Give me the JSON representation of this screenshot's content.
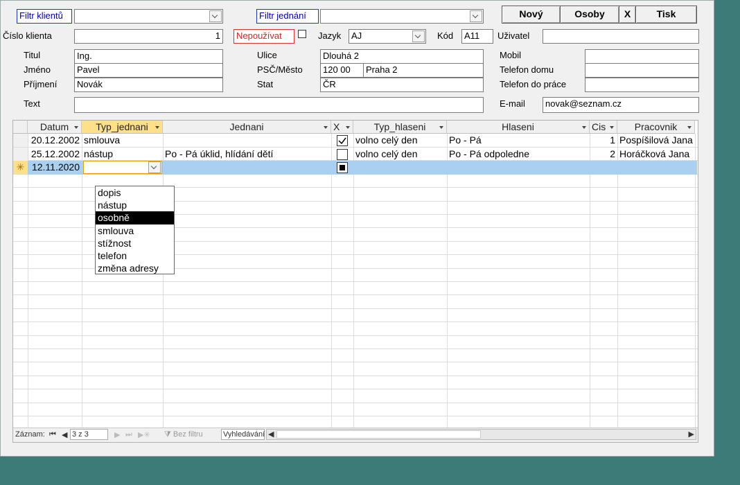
{
  "filters": {
    "client_label": "Filtr klientů",
    "meeting_label": "Filtr jednání",
    "client_value": "",
    "meeting_value": ""
  },
  "buttons": {
    "new": "Nový",
    "persons": "Osoby",
    "close": "X",
    "print": "Tisk"
  },
  "client": {
    "number_label": "Číslo klienta",
    "number": "1",
    "unused_label": "Nepoužívat",
    "unused_checked": false,
    "language_label": "Jazyk",
    "language": "AJ",
    "code_label": "Kód",
    "code": "A11",
    "user_label": "Uživatel",
    "user": "",
    "title_label": "Titul",
    "title": "Ing.",
    "firstname_label": "Jméno",
    "firstname": "Pavel",
    "surname_label": "Příjmení",
    "surname": "Novák",
    "text_label": "Text",
    "text": "",
    "street_label": "Ulice",
    "street": "Dlouhá 2",
    "zipcity_label": "PSČ/Město",
    "zip": "120 00",
    "city": "Praha 2",
    "state_label": "Stat",
    "state": "ČR",
    "mobile_label": "Mobil",
    "mobile": "",
    "phone_home_label": "Telefon domu",
    "phone_home": "",
    "phone_work_label": "Telefon do práce",
    "phone_work": "",
    "email_label": "E-mail",
    "email": "novak@seznam.cz"
  },
  "grid": {
    "columns": [
      "Datum",
      "Typ_jednani",
      "Jednani",
      "X",
      "Typ_hlaseni",
      "Hlaseni",
      "Cis",
      "Pracovnik"
    ],
    "rows": [
      {
        "datum": "20.12.2002",
        "typ": "smlouva",
        "jednani": "",
        "x": "checked",
        "typ_hlaseni": "volno celý den",
        "hlaseni": "Po - Pá",
        "cis": "1",
        "pracovnik": "Pospíšilová Jana"
      },
      {
        "datum": "25.12.2002",
        "typ": "nástup",
        "jednani": "Po - Pá úklid, hlídání dětí",
        "x": "unchecked",
        "typ_hlaseni": "volno celý den",
        "hlaseni": "Po - Pá odpoledne",
        "cis": "2",
        "pracovnik": "Horáčková Jana"
      }
    ],
    "new_row": {
      "marker": "✳",
      "datum": "12.11.2020"
    },
    "dropdown_options": [
      "dopis",
      "nástup",
      "osobně",
      "smlouva",
      "stížnost",
      "telefon",
      "změna adresy"
    ],
    "dropdown_highlight": "osobně"
  },
  "status": {
    "record_label": "Záznam:",
    "record_value": "3 z 3",
    "no_filter": "Bez filtru",
    "search": "Vyhledávání"
  }
}
